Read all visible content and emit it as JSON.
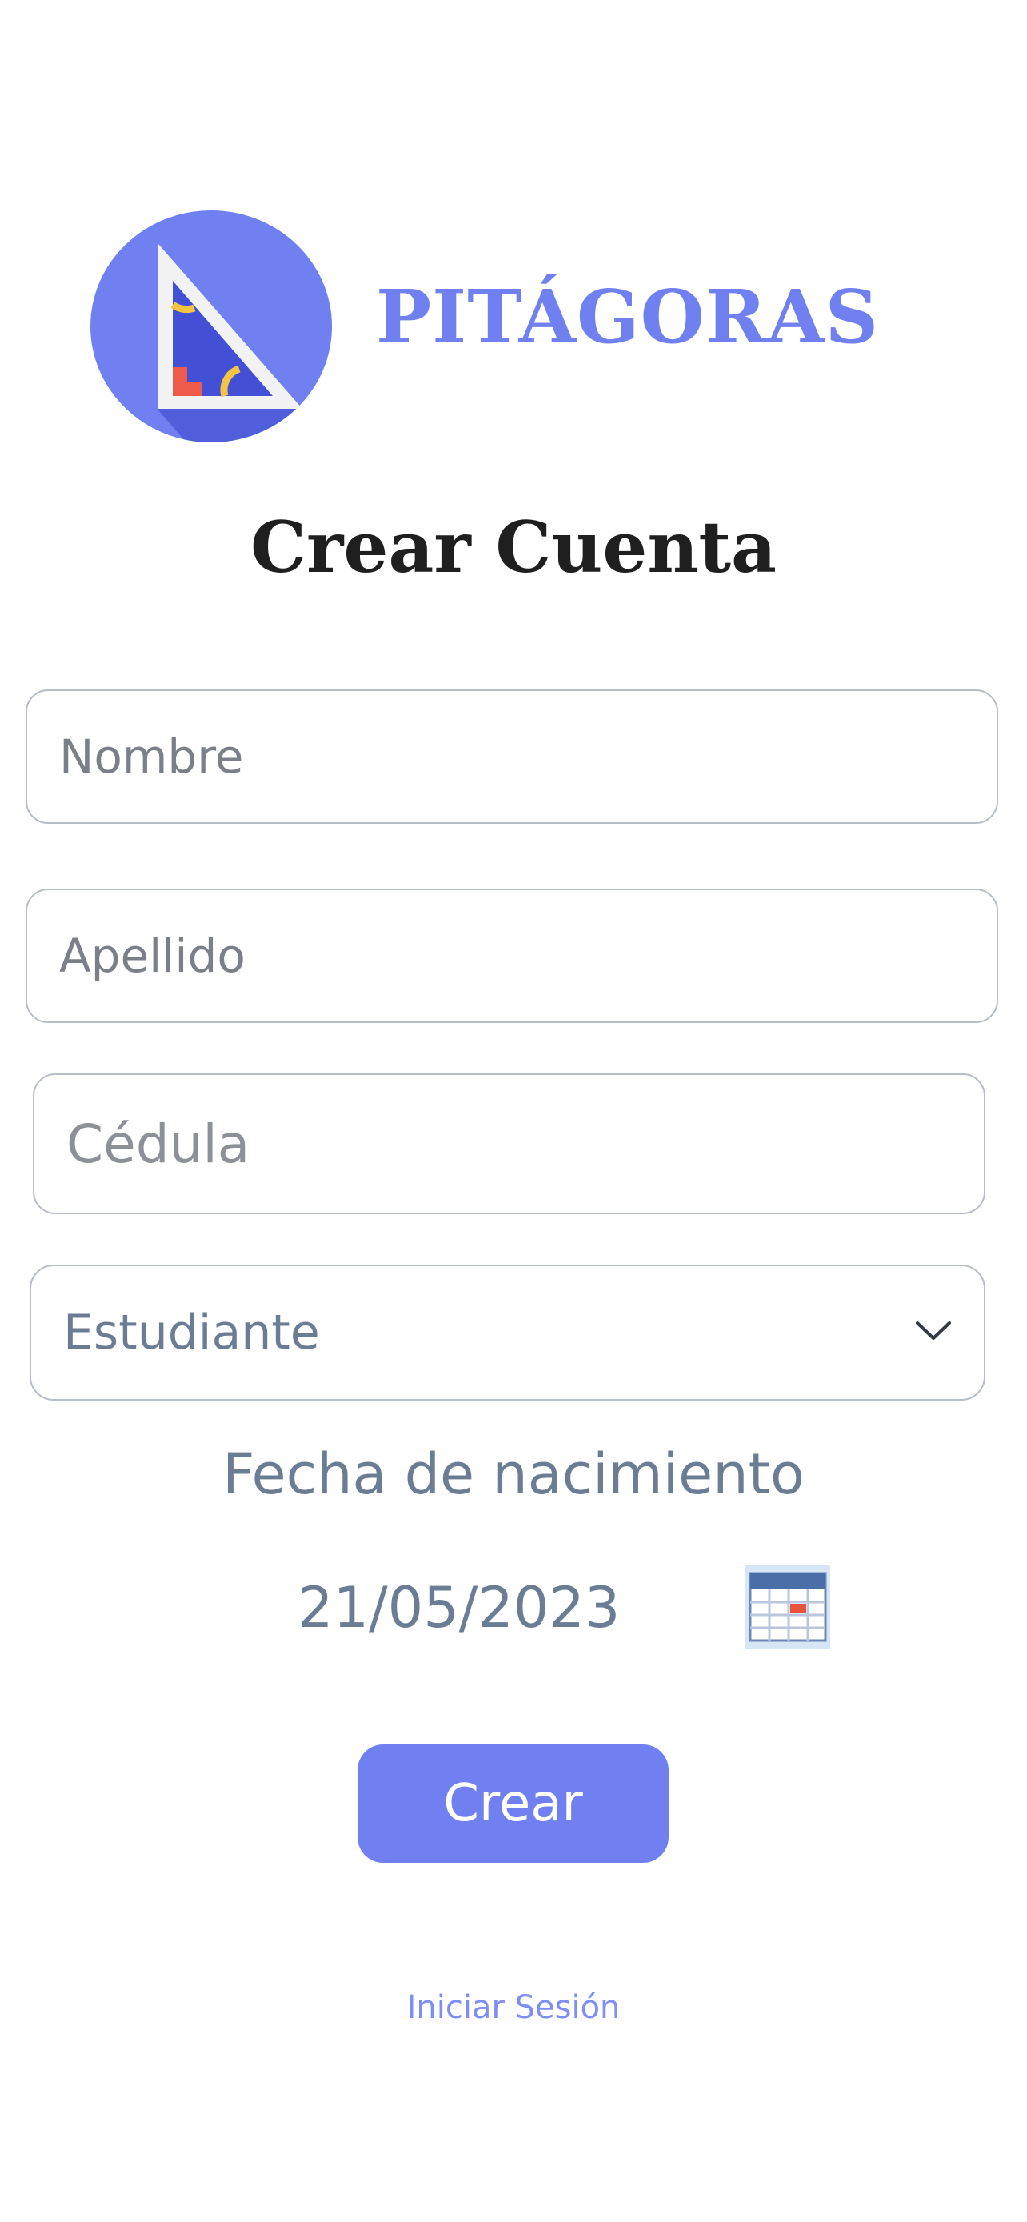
{
  "brand": {
    "name": "PITÁGORAS",
    "logo_icon": "set-square-icon",
    "accent_color": "#7080f0"
  },
  "title": "Crear Cuenta",
  "form": {
    "nombre": {
      "placeholder": "Nombre",
      "value": ""
    },
    "apellido": {
      "placeholder": "Apellido",
      "value": ""
    },
    "cedula": {
      "placeholder": "Cédula",
      "value": ""
    },
    "rol": {
      "selected": "Estudiante",
      "icon": "chevron-down-icon"
    },
    "fecha_nacimiento": {
      "label": "Fecha de nacimiento",
      "value": "21/05/2023",
      "icon": "calendar-icon"
    },
    "submit_label": "Crear"
  },
  "login_link": "Iniciar Sesión"
}
